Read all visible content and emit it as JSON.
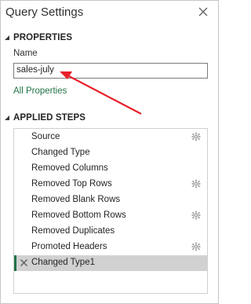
{
  "title": "Query Settings",
  "properties": {
    "header": "PROPERTIES",
    "name_label": "Name",
    "name_value": "sales-july",
    "all_properties_link": "All Properties"
  },
  "applied_steps": {
    "header": "APPLIED STEPS",
    "steps": [
      {
        "label": "Source",
        "gear": true
      },
      {
        "label": "Changed Type",
        "gear": false
      },
      {
        "label": "Removed Columns",
        "gear": false
      },
      {
        "label": "Removed Top Rows",
        "gear": true
      },
      {
        "label": "Removed Blank Rows",
        "gear": false
      },
      {
        "label": "Removed Bottom Rows",
        "gear": true
      },
      {
        "label": "Removed Duplicates",
        "gear": false
      },
      {
        "label": "Promoted Headers",
        "gear": true
      },
      {
        "label": "Changed Type1",
        "gear": false,
        "selected": true
      }
    ]
  },
  "colors": {
    "accent_green": "#217346",
    "annotation_arrow": "#e8202a",
    "selected_row": "#d1d1d1"
  }
}
